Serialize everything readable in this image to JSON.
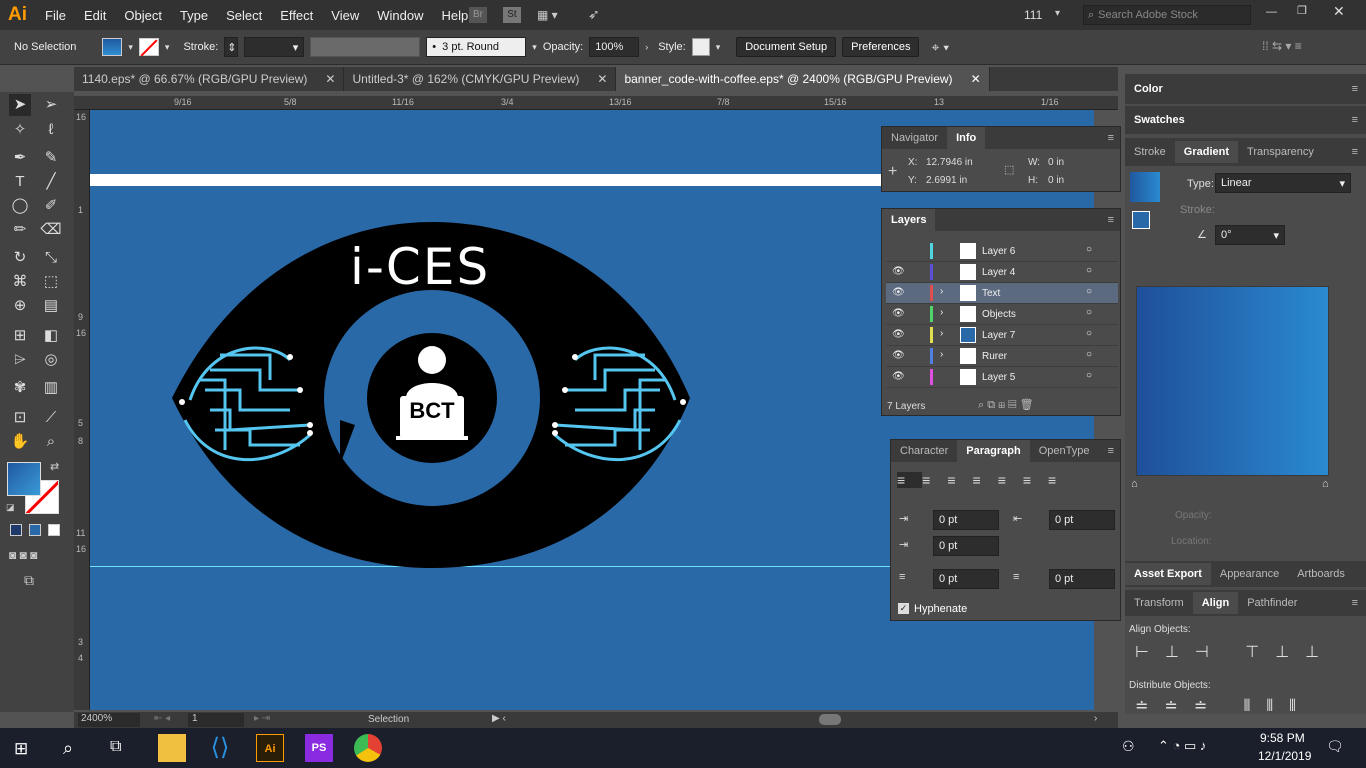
{
  "app": {
    "logo": "Ai",
    "menus": [
      "File",
      "Edit",
      "Object",
      "Type",
      "Select",
      "Effect",
      "View",
      "Window",
      "Help"
    ],
    "bridge": "Br",
    "stock": "St",
    "zoom_display": "111",
    "search_placeholder": "Search Adobe Stock"
  },
  "control": {
    "selection": "No Selection",
    "stroke_label": "Stroke:",
    "brush": "3 pt. Round",
    "opacity_label": "Opacity:",
    "opacity": "100%",
    "style_label": "Style:",
    "doc_setup": "Document Setup",
    "preferences": "Preferences"
  },
  "tabs": [
    {
      "label": "1140.eps* @ 66.67% (RGB/GPU Preview)"
    },
    {
      "label": "Untitled-3* @ 162% (CMYK/GPU Preview)"
    },
    {
      "label": "banner_code-with-coffee.eps* @ 2400% (RGB/GPU Preview)"
    }
  ],
  "ruler_h": [
    "9/16",
    "5/8",
    "11/16",
    "3/4",
    "13/16",
    "7/8",
    "15/16",
    "13",
    "1/16"
  ],
  "ruler_v": [
    "16",
    "1",
    "9",
    "16",
    "5",
    "8",
    "11",
    "16",
    "3",
    "4"
  ],
  "artwork": {
    "title": "i-CES",
    "badge": "BCT"
  },
  "info": {
    "tabs": [
      "Navigator",
      "Info"
    ],
    "x_label": "X:",
    "x": "12.7946 in",
    "y_label": "Y:",
    "y": "2.6991 in",
    "w_label": "W:",
    "w": "0 in",
    "h_label": "H:",
    "h": "0 in"
  },
  "layers": {
    "title": "Layers",
    "count": "7 Layers",
    "items": [
      {
        "name": "Layer 6",
        "color": "#4fd6e0"
      },
      {
        "name": "Layer 4",
        "color": "#5a4fd6"
      },
      {
        "name": "Text",
        "color": "#e04f4f"
      },
      {
        "name": "Objects",
        "color": "#4fd66a"
      },
      {
        "name": "Layer 7",
        "color": "#e0e04f"
      },
      {
        "name": "Rurer",
        "color": "#4f7fe0"
      },
      {
        "name": "Layer 5",
        "color": "#e04fe0"
      }
    ]
  },
  "paragraph": {
    "tabs": [
      "Character",
      "Paragraph",
      "OpenType"
    ],
    "indent_left": "0 pt",
    "indent_right": "0 pt",
    "first_line": "0 pt",
    "space_before": "0 pt",
    "space_after": "0 pt",
    "hyphenate": "Hyphenate"
  },
  "right": {
    "color": "Color",
    "swatches": "Swatches",
    "tabs": [
      "Stroke",
      "Gradient",
      "Transparency"
    ],
    "type_label": "Type:",
    "type": "Linear",
    "stroke_label": "Stroke:",
    "angle": "0°",
    "opacity_label": "Opacity:",
    "location_label": "Location:",
    "asset_tabs": [
      "Asset Export",
      "Appearance",
      "Artboards"
    ],
    "align_tabs": [
      "Transform",
      "Align",
      "Pathfinder"
    ],
    "align_objects": "Align Objects:",
    "distribute_objects": "Distribute Objects:"
  },
  "status": {
    "zoom": "2400%",
    "page": "1",
    "tool": "Selection"
  },
  "taskbar": {
    "time": "9:58 PM",
    "date": "12/1/2019"
  },
  "colors": {
    "canvas": "#2a69a8",
    "accent": "#ff9a00"
  }
}
